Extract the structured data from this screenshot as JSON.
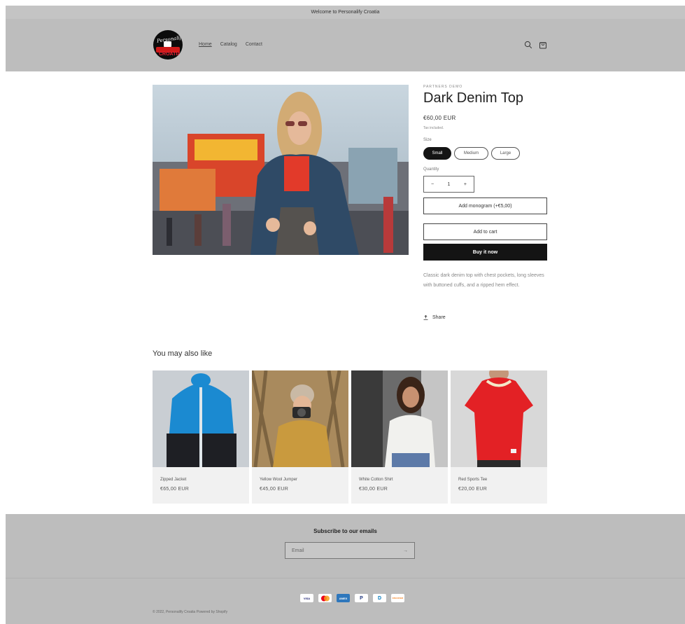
{
  "announcement": "Welcome to Personalify Croatia",
  "header": {
    "logo_text": "Personalify",
    "logo_word": "CROATIA",
    "nav": [
      "Home",
      "Catalog",
      "Contact"
    ],
    "icons": [
      "search-icon",
      "cart-icon"
    ]
  },
  "product": {
    "vendor": "PARTNERS DEMO",
    "title": "Dark Denim Top",
    "price": "€60,00 EUR",
    "tax": "Tax included.",
    "size_label": "Size",
    "sizes": [
      "Small",
      "Medium",
      "Large"
    ],
    "selected_size": "Small",
    "quantity_label": "Quantity",
    "quantity": "1",
    "minus": "−",
    "plus": "+",
    "monogram_button": "Add monogram (+€5,00)",
    "add_to_cart": "Add to cart",
    "buy_now": "Buy it now",
    "description": "Classic dark denim top with chest pockets, long sleeves with buttoned cuffs, and a ripped hem effect.",
    "share": "Share"
  },
  "recommendations": {
    "title": "You may also like",
    "items": [
      {
        "name": "Zipped Jacket",
        "price": "€65,00 EUR"
      },
      {
        "name": "Yellow Wool Jumper",
        "price": "€45,00 EUR"
      },
      {
        "name": "White Cotton Shirt",
        "price": "€30,00 EUR"
      },
      {
        "name": "Red Sports Tee",
        "price": "€20,00 EUR"
      }
    ]
  },
  "newsletter": {
    "title": "Subscribe to our emails",
    "email_placeholder": "Email",
    "arrow": "→"
  },
  "footer": {
    "payment_icons": [
      "VISA",
      "MC",
      "AMEX",
      "P",
      "D",
      "DISCOVER"
    ],
    "copyright": "© 2022, Personalify Croatia Powered by Shopify"
  }
}
